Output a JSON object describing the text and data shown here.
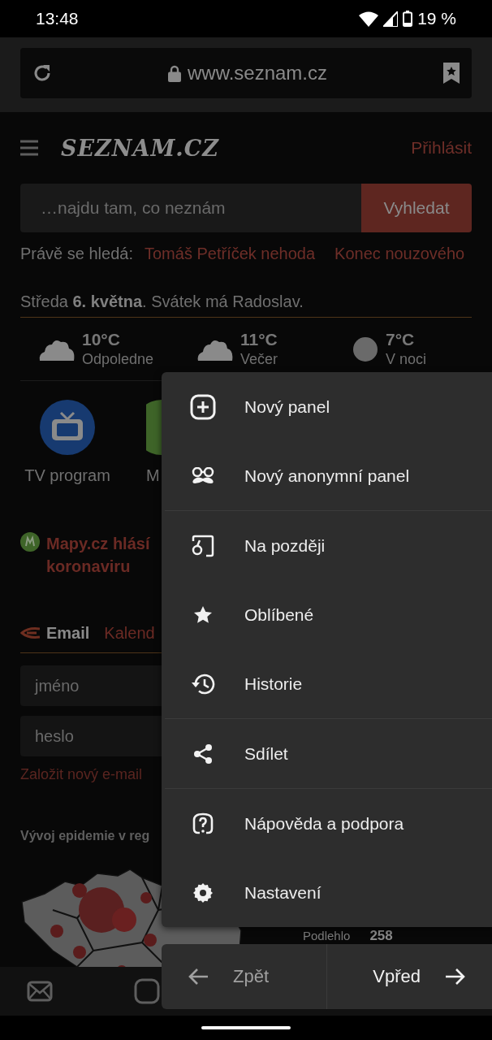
{
  "status_bar": {
    "time": "13:48",
    "battery": "19 %"
  },
  "url_bar": {
    "url": "www.seznam.cz"
  },
  "page": {
    "logo": "SEZNAM.CZ",
    "login": "Přihlásit",
    "search": {
      "placeholder": "…najdu tam, co neznám",
      "button": "Vyhledat"
    },
    "trending": {
      "label": "Právě se hledá:",
      "items": [
        "Tomáš Petříček nehoda",
        "Konec nouzového"
      ]
    },
    "date_line": "Středa **6. května**. Svátek má Radoslav.",
    "weather": [
      {
        "temp": "10°C",
        "period": "Odpoledne",
        "kind": "cloud"
      },
      {
        "temp": "11°C",
        "period": "Večer",
        "kind": "cloud"
      },
      {
        "temp": "7°C",
        "period": "V noci",
        "kind": "moon"
      }
    ],
    "apps": [
      {
        "label": "TV program",
        "kind": "tv"
      },
      {
        "label": "M",
        "kind": "map"
      }
    ],
    "news": {
      "lines": [
        "Mapy.cz hlásí",
        "koronaviru"
      ]
    },
    "mail_tabs": [
      {
        "label": "Email",
        "selected": true
      },
      {
        "label": "Kalend",
        "selected": false
      }
    ],
    "login_fields": [
      {
        "placeholder": "jméno"
      },
      {
        "placeholder": "heslo"
      }
    ],
    "create_link": "Založit nový e-mail",
    "epidemic": {
      "title": "Vývoj epidemie v reg",
      "stat_label": "Podlehlo",
      "stat_value": "258"
    }
  },
  "menu": {
    "groups": [
      [
        {
          "label": "Nový panel",
          "kind": "new-tab"
        },
        {
          "label": "Nový anonymní panel",
          "kind": "incognito"
        }
      ],
      [
        {
          "label": "Na později",
          "kind": "later"
        },
        {
          "label": "Oblíbené",
          "kind": "star"
        },
        {
          "label": "Historie",
          "kind": "history"
        }
      ],
      [
        {
          "label": "Sdílet",
          "kind": "share"
        }
      ],
      [
        {
          "label": "Nápověda a podpora",
          "kind": "help"
        },
        {
          "label": "Nastavení",
          "kind": "settings"
        }
      ]
    ]
  },
  "navigation": [
    {
      "label": "Zpět",
      "kind": "back",
      "disabled": true
    },
    {
      "label": "Vpřed",
      "kind": "forward",
      "disabled": false
    }
  ]
}
